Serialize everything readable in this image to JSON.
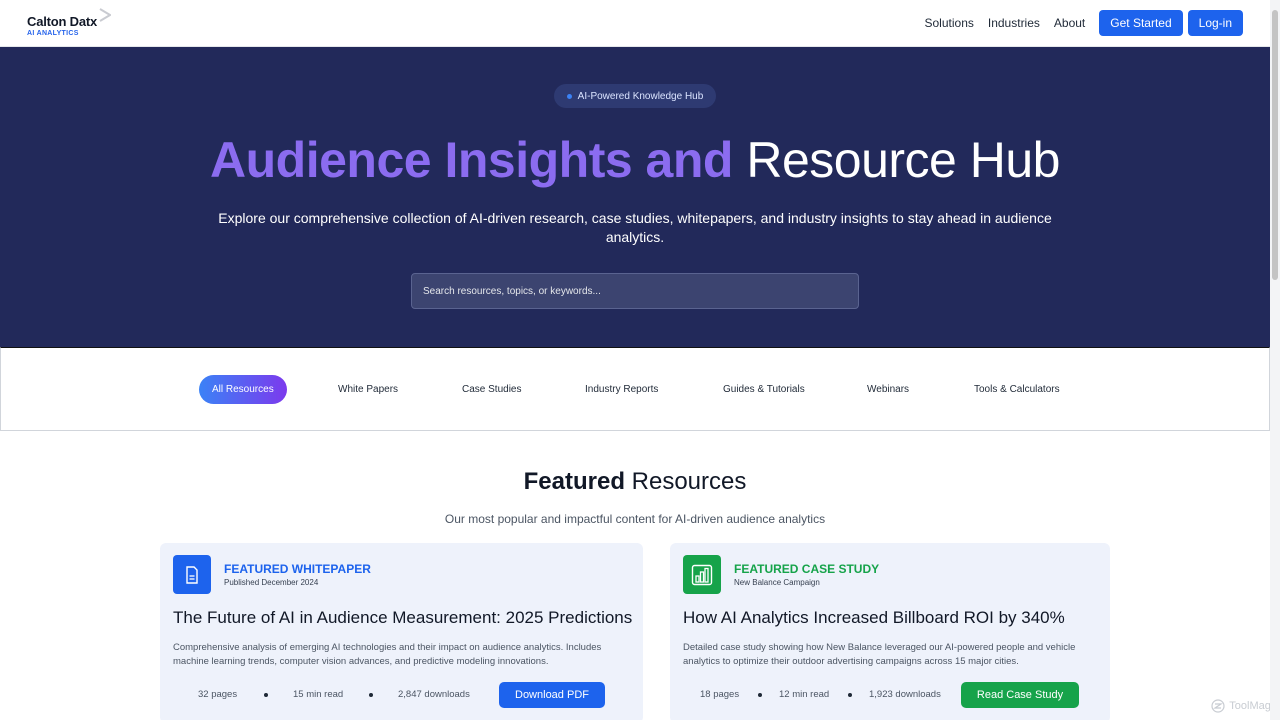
{
  "header": {
    "logo_name": "Calton Datx",
    "logo_sub": "AI ANALYTICS",
    "nav": [
      "Solutions",
      "Industries",
      "About"
    ],
    "cta_primary": "Get Started",
    "cta_login": "Log-in"
  },
  "hero": {
    "pill": "AI-Powered Knowledge Hub",
    "title_highlight": "Audience Insights and",
    "title_plain": "Resource Hub",
    "description": "Explore our comprehensive collection of AI-driven research, case studies, whitepapers, and industry insights to stay ahead in audience analytics.",
    "search_placeholder": "Search resources, topics, or keywords..."
  },
  "filters": [
    "All Resources",
    "White Papers",
    "Case Studies",
    "Industry Reports",
    "Guides & Tutorials",
    "Webinars",
    "Tools & Calculators"
  ],
  "featured": {
    "title_bold": "Featured",
    "title_plain": "Resources",
    "subtitle": "Our most popular and impactful content for AI-driven audience analytics",
    "cards": [
      {
        "kicker": "FEATURED WHITEPAPER",
        "meta": "Published December 2024",
        "title": "The Future of AI in Audience Measurement: 2025 Predictions",
        "description": "Comprehensive analysis of emerging AI technologies and their impact on audience analytics. Includes machine learning trends, computer vision advances, and predictive modeling innovations.",
        "stats": [
          "32 pages",
          "15 min read",
          "2,847 downloads"
        ],
        "button": "Download PDF",
        "color": "#1d63ed",
        "icon": "document-icon"
      },
      {
        "kicker": "FEATURED CASE STUDY",
        "meta": "New Balance Campaign",
        "title": "How AI Analytics Increased Billboard ROI by 340%",
        "description": "Detailed case study showing how New Balance leveraged our AI-powered people and vehicle analytics to optimize their outdoor advertising campaigns across 15 major cities.",
        "stats": [
          "18 pages",
          "12 min read",
          "1,923 downloads"
        ],
        "button": "Read Case Study",
        "color": "#16a34a",
        "icon": "bar-chart-icon"
      }
    ]
  },
  "watermark": "ToolMage"
}
